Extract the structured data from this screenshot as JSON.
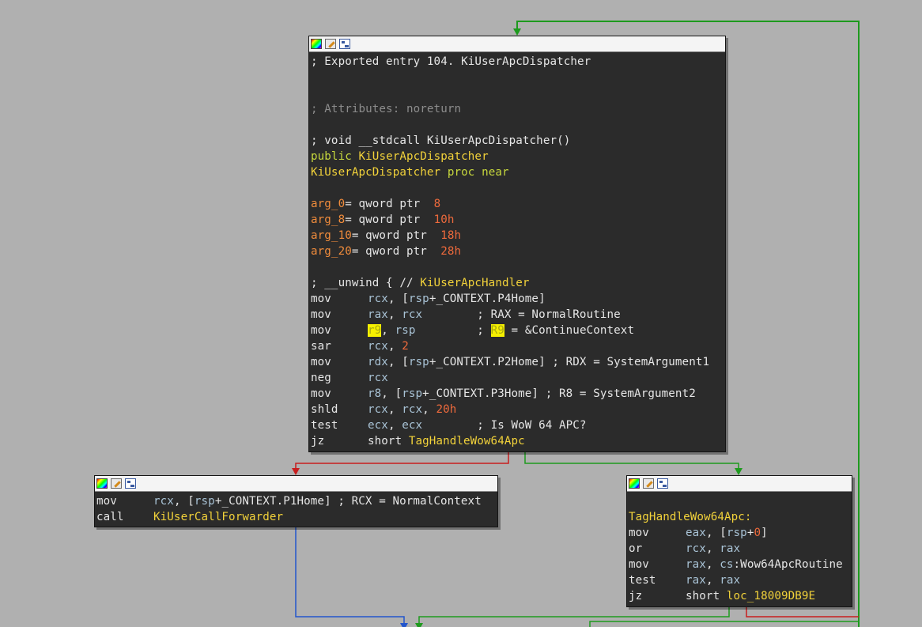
{
  "colors": {
    "background": "#b0b0b0",
    "node_bg": "#2b2b2b",
    "edge_true": "#1e9a1e",
    "edge_false": "#c81e1e",
    "edge_uncond": "#2255cc",
    "name": "#f2d23a",
    "keyword": "#c7d83d",
    "var": "#f08c3c",
    "number": "#ee6a3c",
    "register": "#a9c3d6",
    "highlight": "#f5f000"
  },
  "icons": [
    "color-palette-icon",
    "edit-pencil-icon",
    "graph-overview-icon"
  ],
  "main_block": {
    "comment_export": "; Exported entry 104. KiUserApcDispatcher",
    "comment_attr": "; Attributes: noreturn",
    "comment_proto": "; void __stdcall KiUserApcDispatcher()",
    "public_kw": "public",
    "func_name": "KiUserApcDispatcher",
    "proc_kw": "proc near",
    "args": [
      {
        "name": "arg_0",
        "op": "= qword ptr  ",
        "val": "8"
      },
      {
        "name": "arg_8",
        "op": "= qword ptr  ",
        "val": "10h"
      },
      {
        "name": "arg_10",
        "op": "= qword ptr  ",
        "val": "18h"
      },
      {
        "name": "arg_20",
        "op": "= qword ptr  ",
        "val": "28h"
      }
    ],
    "unwind_prefix": "; __unwind { // ",
    "unwind_handler": "KiUserApcHandler",
    "i1_m": "mov",
    "i1_r": "rcx",
    "i1_a": ", [",
    "i1_b": "rsp",
    "i1_c": "+_CONTEXT.P4Home]",
    "i2_m": "mov",
    "i2_r": "rax",
    "i2_a": ", ",
    "i2_b": "rcx",
    "i2_c": "        ; RAX = NormalRoutine",
    "i3_m": "mov",
    "i3_r": "r9",
    "i3_a": ", ",
    "i3_b": "rsp",
    "i3_c": "         ; ",
    "i3_d": "R9",
    "i3_e": " = &ContinueContext",
    "i4_m": "sar",
    "i4_r": "rcx",
    "i4_a": ", ",
    "i4_n": "2",
    "i5_m": "mov",
    "i5_r": "rdx",
    "i5_a": ", [",
    "i5_b": "rsp",
    "i5_c": "+_CONTEXT.P2Home] ; RDX = SystemArgument1",
    "i6_m": "neg",
    "i6_r": "rcx",
    "i7_m": "mov",
    "i7_r": "r8",
    "i7_a": ", [",
    "i7_b": "rsp",
    "i7_c": "+_CONTEXT.P3Home] ; R8 = SystemArgument2",
    "i8_m": "shld",
    "i8_r": "rcx",
    "i8_a": ", ",
    "i8_b": "rcx",
    "i8_c": ", ",
    "i8_n": "20h",
    "i9_m": "test",
    "i9_r": "ecx",
    "i9_a": ", ",
    "i9_b": "ecx",
    "i9_c": "        ; Is WoW 64 APC?",
    "i10_m": "jz",
    "i10_a": "short ",
    "i10_t": "TagHandleWow64Apc"
  },
  "left_block": {
    "i1_m": "mov",
    "i1_r": "rcx",
    "i1_a": ", [",
    "i1_b": "rsp",
    "i1_c": "+_CONTEXT.P1Home] ; RCX = NormalContext",
    "i2_m": "call",
    "i2_t": "KiUserCallForwarder"
  },
  "right_block": {
    "label": "TagHandleWow64Apc:",
    "i1_m": "mov",
    "i1_r": "eax",
    "i1_a": ", [",
    "i1_b": "rsp",
    "i1_c": "+",
    "i1_n": "0",
    "i1_d": "]",
    "i2_m": "or",
    "i2_r": "rcx",
    "i2_a": ", ",
    "i2_b": "rax",
    "i3_m": "mov",
    "i3_r": "rax",
    "i3_a": ", ",
    "i3_b": "cs",
    "i3_c": ":Wow64ApcRoutine",
    "i4_m": "test",
    "i4_r": "rax",
    "i4_a": ", ",
    "i4_b": "rax",
    "i5_m": "jz",
    "i5_a": "short ",
    "i5_t": "loc_18009DB9E"
  }
}
